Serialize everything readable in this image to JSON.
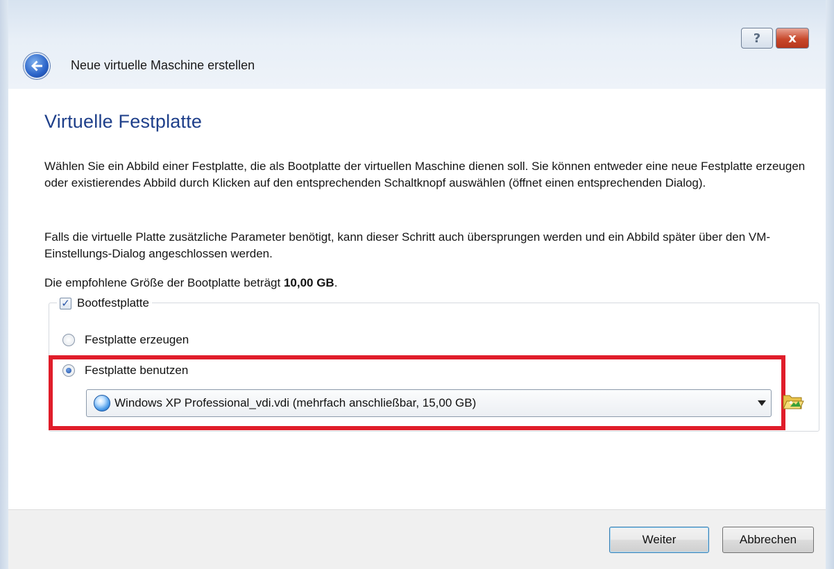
{
  "window": {
    "nav_title": "Neue virtuelle Maschine erstellen",
    "help_label": "?",
    "close_label": "x"
  },
  "page": {
    "title": "Virtuelle Festplatte",
    "paragraph1": "Wählen Sie ein Abbild einer Festplatte, die als Bootplatte der virtuellen Maschine dienen soll. Sie können entweder eine neue Festplatte erzeugen oder existierendes Abbild durch Klicken auf den entsprechenden Schaltknopf auswählen (öffnet einen entsprechenden Dialog).",
    "paragraph2": "Falls die virtuelle Platte zusätzliche Parameter benötigt, kann dieser Schritt auch übersprungen werden und ein Abbild später über den VM-Einstellungs-Dialog angeschlossen werden.",
    "recommended_prefix": "Die empfohlene Größe der Bootplatte beträgt ",
    "recommended_size": "10,00 GB",
    "recommended_suffix": "."
  },
  "bootdisk": {
    "checkbox_label": "Bootfestplatte",
    "checked": true,
    "options": [
      {
        "label": "Festplatte erzeugen",
        "selected": false
      },
      {
        "label": "Festplatte benutzen",
        "selected": true
      }
    ],
    "selected_image": "Windows XP Professional_vdi.vdi (mehrfach anschließbar, 15,00 GB)",
    "highlight_color": "#e01d2a"
  },
  "footer": {
    "next_label": "Weiter",
    "cancel_label": "Abbrechen"
  },
  "icons": [
    "back-arrow-icon",
    "hard-disk-icon",
    "folder-open-icon",
    "dropdown-arrow-icon",
    "help-icon",
    "close-icon"
  ]
}
